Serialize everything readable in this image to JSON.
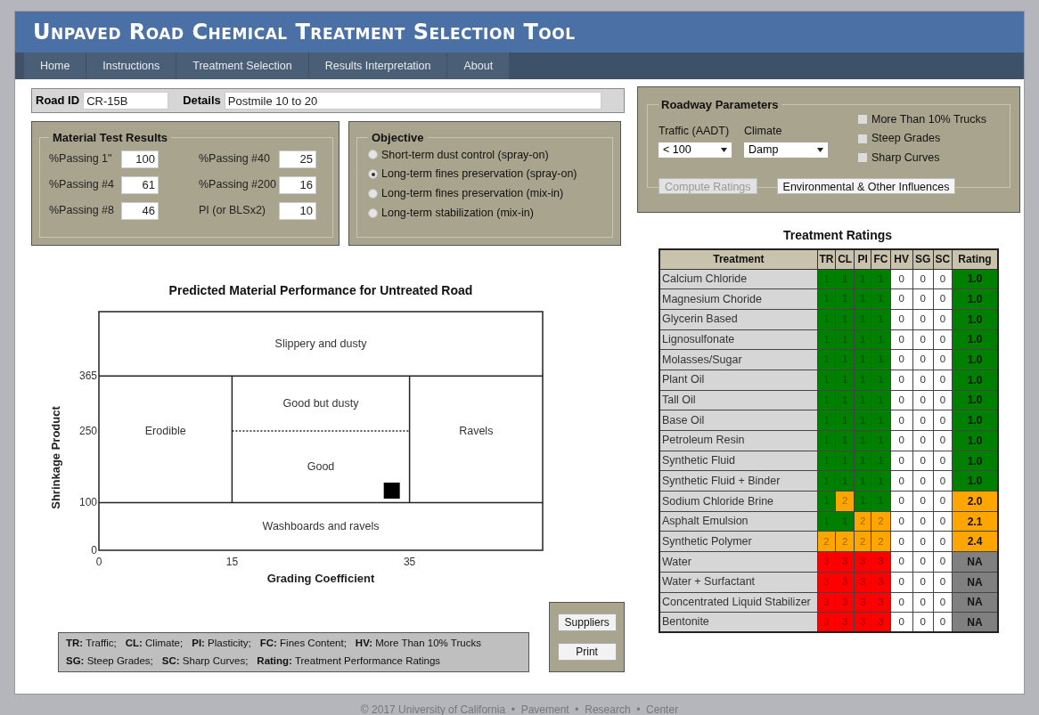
{
  "header": {
    "title": "Unpaved Road Chemical Treatment Selection Tool"
  },
  "nav": [
    "Home",
    "Instructions",
    "Treatment Selection",
    "Results Interpretation",
    "About"
  ],
  "road": {
    "id_label": "Road ID",
    "id_value": "CR-15B",
    "details_label": "Details",
    "details_value": "Postmile 10 to 20"
  },
  "material_tests": {
    "title": "Material Test Results",
    "fields": [
      {
        "label": "%Passing 1\"",
        "value": "100"
      },
      {
        "label": "%Passing #40",
        "value": "25"
      },
      {
        "label": "%Passing #4",
        "value": "61"
      },
      {
        "label": "%Passing #200",
        "value": "16"
      },
      {
        "label": "%Passing #8",
        "value": "46"
      },
      {
        "label": "PI (or BLSx2)",
        "value": "10"
      }
    ]
  },
  "objective": {
    "title": "Objective",
    "options": [
      {
        "label": "Short-term dust control (spray-on)",
        "selected": false
      },
      {
        "label": "Long-term fines preservation (spray-on)",
        "selected": true
      },
      {
        "label": "Long-term fines preservation (mix-in)",
        "selected": false
      },
      {
        "label": "Long-term stabilization (mix-in)",
        "selected": false
      }
    ]
  },
  "roadway": {
    "title": "Roadway Parameters",
    "traffic_label": "Traffic (AADT)",
    "traffic_value": "< 100",
    "climate_label": "Climate",
    "climate_value": "Damp",
    "checkboxes": [
      {
        "label": "More Than 10% Trucks",
        "checked": false
      },
      {
        "label": "Steep Grades",
        "checked": false
      },
      {
        "label": "Sharp Curves",
        "checked": false
      }
    ],
    "buttons": [
      {
        "label": "Compute Ratings",
        "disabled": true
      },
      {
        "label": "Environmental & Other Influences",
        "disabled": false
      }
    ]
  },
  "chart": {
    "chart_data": {
      "type": "scatter",
      "title": "Predicted Material Performance for Untreated Road",
      "xlabel": "Grading Coefficient",
      "ylabel": "Shrinkage Product",
      "x": [
        33
      ],
      "series": [
        {
          "color": "#000000",
          "values": [
            125
          ]
        }
      ],
      "xlim": [
        0,
        50
      ],
      "ylim": [
        0,
        500
      ],
      "xticks": [
        0,
        15,
        35
      ],
      "yticks": [
        0,
        100,
        250,
        365
      ],
      "ref_lines": [
        {
          "axis": "y",
          "value": 365
        },
        {
          "axis": "y",
          "value": 100
        },
        {
          "axis": "x",
          "value": 15
        },
        {
          "axis": "x",
          "value": 35
        },
        {
          "axis": "y",
          "value": 250
        }
      ],
      "annotations": [
        "Slippery and dusty",
        "Erodible",
        "Good but dusty",
        "Good",
        "Ravels",
        "Washboards and ravels"
      ]
    }
  },
  "ratings": {
    "title": "Treatment Ratings",
    "columns": [
      "Treatment",
      "TR",
      "CL",
      "PI",
      "FC",
      "HV",
      "SG",
      "SC",
      "Rating"
    ],
    "rows": [
      [
        {
          "text": "Calcium Chloride"
        },
        {
          "text": "1",
          "color": "#008000"
        },
        {
          "text": "1",
          "color": "#008000"
        },
        {
          "text": "1",
          "color": "#008000"
        },
        {
          "text": "1",
          "color": "#008000"
        },
        {
          "text": "0",
          "color": "#ffffff"
        },
        {
          "text": "0",
          "color": "#ffffff"
        },
        {
          "text": "0",
          "color": "#ffffff"
        },
        {
          "text": "1.0",
          "color": "#008000"
        }
      ],
      [
        {
          "text": "Magnesium Choride"
        },
        {
          "text": "1",
          "color": "#008000"
        },
        {
          "text": "1",
          "color": "#008000"
        },
        {
          "text": "1",
          "color": "#008000"
        },
        {
          "text": "1",
          "color": "#008000"
        },
        {
          "text": "0",
          "color": "#ffffff"
        },
        {
          "text": "0",
          "color": "#ffffff"
        },
        {
          "text": "0",
          "color": "#ffffff"
        },
        {
          "text": "1.0",
          "color": "#008000"
        }
      ],
      [
        {
          "text": "Glycerin Based"
        },
        {
          "text": "1",
          "color": "#008000"
        },
        {
          "text": "1",
          "color": "#008000"
        },
        {
          "text": "1",
          "color": "#008000"
        },
        {
          "text": "1",
          "color": "#008000"
        },
        {
          "text": "0",
          "color": "#ffffff"
        },
        {
          "text": "0",
          "color": "#ffffff"
        },
        {
          "text": "0",
          "color": "#ffffff"
        },
        {
          "text": "1.0",
          "color": "#008000"
        }
      ],
      [
        {
          "text": "Lignosulfonate"
        },
        {
          "text": "1",
          "color": "#008000"
        },
        {
          "text": "1",
          "color": "#008000"
        },
        {
          "text": "1",
          "color": "#008000"
        },
        {
          "text": "1",
          "color": "#008000"
        },
        {
          "text": "0",
          "color": "#ffffff"
        },
        {
          "text": "0",
          "color": "#ffffff"
        },
        {
          "text": "0",
          "color": "#ffffff"
        },
        {
          "text": "1.0",
          "color": "#008000"
        }
      ],
      [
        {
          "text": "Molasses/Sugar"
        },
        {
          "text": "1",
          "color": "#008000"
        },
        {
          "text": "1",
          "color": "#008000"
        },
        {
          "text": "1",
          "color": "#008000"
        },
        {
          "text": "1",
          "color": "#008000"
        },
        {
          "text": "0",
          "color": "#ffffff"
        },
        {
          "text": "0",
          "color": "#ffffff"
        },
        {
          "text": "0",
          "color": "#ffffff"
        },
        {
          "text": "1.0",
          "color": "#008000"
        }
      ],
      [
        {
          "text": "Plant Oil"
        },
        {
          "text": "1",
          "color": "#008000"
        },
        {
          "text": "1",
          "color": "#008000"
        },
        {
          "text": "1",
          "color": "#008000"
        },
        {
          "text": "1",
          "color": "#008000"
        },
        {
          "text": "0",
          "color": "#ffffff"
        },
        {
          "text": "0",
          "color": "#ffffff"
        },
        {
          "text": "0",
          "color": "#ffffff"
        },
        {
          "text": "1.0",
          "color": "#008000"
        }
      ],
      [
        {
          "text": "Tall Oil"
        },
        {
          "text": "1",
          "color": "#008000"
        },
        {
          "text": "1",
          "color": "#008000"
        },
        {
          "text": "1",
          "color": "#008000"
        },
        {
          "text": "1",
          "color": "#008000"
        },
        {
          "text": "0",
          "color": "#ffffff"
        },
        {
          "text": "0",
          "color": "#ffffff"
        },
        {
          "text": "0",
          "color": "#ffffff"
        },
        {
          "text": "1.0",
          "color": "#008000"
        }
      ],
      [
        {
          "text": "Base Oil"
        },
        {
          "text": "1",
          "color": "#008000"
        },
        {
          "text": "1",
          "color": "#008000"
        },
        {
          "text": "1",
          "color": "#008000"
        },
        {
          "text": "1",
          "color": "#008000"
        },
        {
          "text": "0",
          "color": "#ffffff"
        },
        {
          "text": "0",
          "color": "#ffffff"
        },
        {
          "text": "0",
          "color": "#ffffff"
        },
        {
          "text": "1.0",
          "color": "#008000"
        }
      ],
      [
        {
          "text": "Petroleum Resin"
        },
        {
          "text": "1",
          "color": "#008000"
        },
        {
          "text": "1",
          "color": "#008000"
        },
        {
          "text": "1",
          "color": "#008000"
        },
        {
          "text": "1",
          "color": "#008000"
        },
        {
          "text": "0",
          "color": "#ffffff"
        },
        {
          "text": "0",
          "color": "#ffffff"
        },
        {
          "text": "0",
          "color": "#ffffff"
        },
        {
          "text": "1.0",
          "color": "#008000"
        }
      ],
      [
        {
          "text": "Synthetic Fluid"
        },
        {
          "text": "1",
          "color": "#008000"
        },
        {
          "text": "1",
          "color": "#008000"
        },
        {
          "text": "1",
          "color": "#008000"
        },
        {
          "text": "1",
          "color": "#008000"
        },
        {
          "text": "0",
          "color": "#ffffff"
        },
        {
          "text": "0",
          "color": "#ffffff"
        },
        {
          "text": "0",
          "color": "#ffffff"
        },
        {
          "text": "1.0",
          "color": "#008000"
        }
      ],
      [
        {
          "text": "Synthetic Fluid + Binder"
        },
        {
          "text": "1",
          "color": "#008000"
        },
        {
          "text": "1",
          "color": "#008000"
        },
        {
          "text": "1",
          "color": "#008000"
        },
        {
          "text": "1",
          "color": "#008000"
        },
        {
          "text": "0",
          "color": "#ffffff"
        },
        {
          "text": "0",
          "color": "#ffffff"
        },
        {
          "text": "0",
          "color": "#ffffff"
        },
        {
          "text": "1.0",
          "color": "#008000"
        }
      ],
      [
        {
          "text": "Sodium Chloride Brine"
        },
        {
          "text": "1",
          "color": "#008000"
        },
        {
          "text": "2",
          "color": "#ffa500"
        },
        {
          "text": "1",
          "color": "#008000"
        },
        {
          "text": "1",
          "color": "#008000"
        },
        {
          "text": "0",
          "color": "#ffffff"
        },
        {
          "text": "0",
          "color": "#ffffff"
        },
        {
          "text": "0",
          "color": "#ffffff"
        },
        {
          "text": "2.0",
          "color": "#ffa500"
        }
      ],
      [
        {
          "text": "Asphalt Emulsion"
        },
        {
          "text": "1",
          "color": "#008000"
        },
        {
          "text": "1",
          "color": "#008000"
        },
        {
          "text": "2",
          "color": "#ffa500"
        },
        {
          "text": "2",
          "color": "#ffa500"
        },
        {
          "text": "0",
          "color": "#ffffff"
        },
        {
          "text": "0",
          "color": "#ffffff"
        },
        {
          "text": "0",
          "color": "#ffffff"
        },
        {
          "text": "2.1",
          "color": "#ffa500"
        }
      ],
      [
        {
          "text": "Synthetic Polymer"
        },
        {
          "text": "2",
          "color": "#ffa500"
        },
        {
          "text": "2",
          "color": "#ffa500"
        },
        {
          "text": "2",
          "color": "#ffa500"
        },
        {
          "text": "2",
          "color": "#ffa500"
        },
        {
          "text": "0",
          "color": "#ffffff"
        },
        {
          "text": "0",
          "color": "#ffffff"
        },
        {
          "text": "0",
          "color": "#ffffff"
        },
        {
          "text": "2.4",
          "color": "#ffa500"
        }
      ],
      [
        {
          "text": "Water"
        },
        {
          "text": "3",
          "color": "#ff0000"
        },
        {
          "text": "3",
          "color": "#ff0000"
        },
        {
          "text": "3",
          "color": "#ff0000"
        },
        {
          "text": "3",
          "color": "#ff0000"
        },
        {
          "text": "0",
          "color": "#ffffff"
        },
        {
          "text": "0",
          "color": "#ffffff"
        },
        {
          "text": "0",
          "color": "#ffffff"
        },
        {
          "text": "NA",
          "color": "#808080"
        }
      ],
      [
        {
          "text": "Water + Surfactant"
        },
        {
          "text": "3",
          "color": "#ff0000"
        },
        {
          "text": "3",
          "color": "#ff0000"
        },
        {
          "text": "3",
          "color": "#ff0000"
        },
        {
          "text": "3",
          "color": "#ff0000"
        },
        {
          "text": "0",
          "color": "#ffffff"
        },
        {
          "text": "0",
          "color": "#ffffff"
        },
        {
          "text": "0",
          "color": "#ffffff"
        },
        {
          "text": "NA",
          "color": "#808080"
        }
      ],
      [
        {
          "text": "Concentrated Liquid Stabilizer"
        },
        {
          "text": "3",
          "color": "#ff0000"
        },
        {
          "text": "3",
          "color": "#ff0000"
        },
        {
          "text": "3",
          "color": "#ff0000"
        },
        {
          "text": "3",
          "color": "#ff0000"
        },
        {
          "text": "0",
          "color": "#ffffff"
        },
        {
          "text": "0",
          "color": "#ffffff"
        },
        {
          "text": "0",
          "color": "#ffffff"
        },
        {
          "text": "NA",
          "color": "#808080"
        }
      ],
      [
        {
          "text": "Bentonite"
        },
        {
          "text": "3",
          "color": "#ff0000"
        },
        {
          "text": "3",
          "color": "#ff0000"
        },
        {
          "text": "3",
          "color": "#ff0000"
        },
        {
          "text": "3",
          "color": "#ff0000"
        },
        {
          "text": "0",
          "color": "#ffffff"
        },
        {
          "text": "0",
          "color": "#ffffff"
        },
        {
          "text": "0",
          "color": "#ffffff"
        },
        {
          "text": "NA",
          "color": "#808080"
        }
      ]
    ]
  },
  "legend": [
    [
      "**TR:** Traffic;",
      "**CL:** Climate;",
      "**PI:** Plasticity;",
      "**FC:** Fines Content;",
      "**HV:** More Than 10% Trucks"
    ],
    [
      "**SG:** Steep Grades;",
      "**SC:** Sharp Curves;",
      "**Rating:** Treatment Performance Ratings"
    ]
  ],
  "actions": [
    "Suppliers",
    "Print"
  ],
  "footer": "© 2017 University of California  •  Pavement  •  Research  •  Center"
}
